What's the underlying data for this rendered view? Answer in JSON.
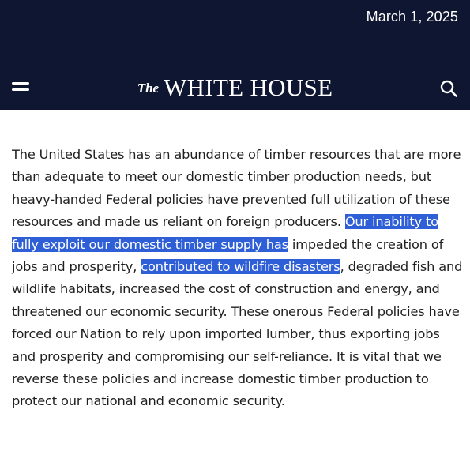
{
  "header": {
    "date": "March 1, 2025",
    "logo_the": "The",
    "logo_main": "WHITE HOUSE",
    "menu_icon": "hamburger-menu-icon",
    "search_icon": "search-icon",
    "colors": {
      "background": "#0f1632",
      "text": "#ffffff"
    }
  },
  "article": {
    "text_before_highlight": "The United States has an abundance of timber resources that are more than adequate to meet our domestic timber production needs, but heavy-handed Federal policies have prevented full utilization of these resources and made us reliant on foreign producers.  ",
    "highlight_1": "Our inability to fully exploit our domestic timber supply has",
    "text_middle": " impeded the creation of jobs and prosperity, ",
    "highlight_2": "contributed to wildfire disasters",
    "text_after": ", degraded fish and wildlife habitats, increased the cost of construction and energy, and threatened our economic security.  These onerous Federal policies have forced our Nation to rely upon imported lumber, thus exporting jobs and prosperity and compromising our self-reliance.  It is vital that we reverse these policies and increase domestic timber production to protect our national and economic security.",
    "colors": {
      "text": "#1f1f1f",
      "selection": "#2f5fd6"
    }
  }
}
